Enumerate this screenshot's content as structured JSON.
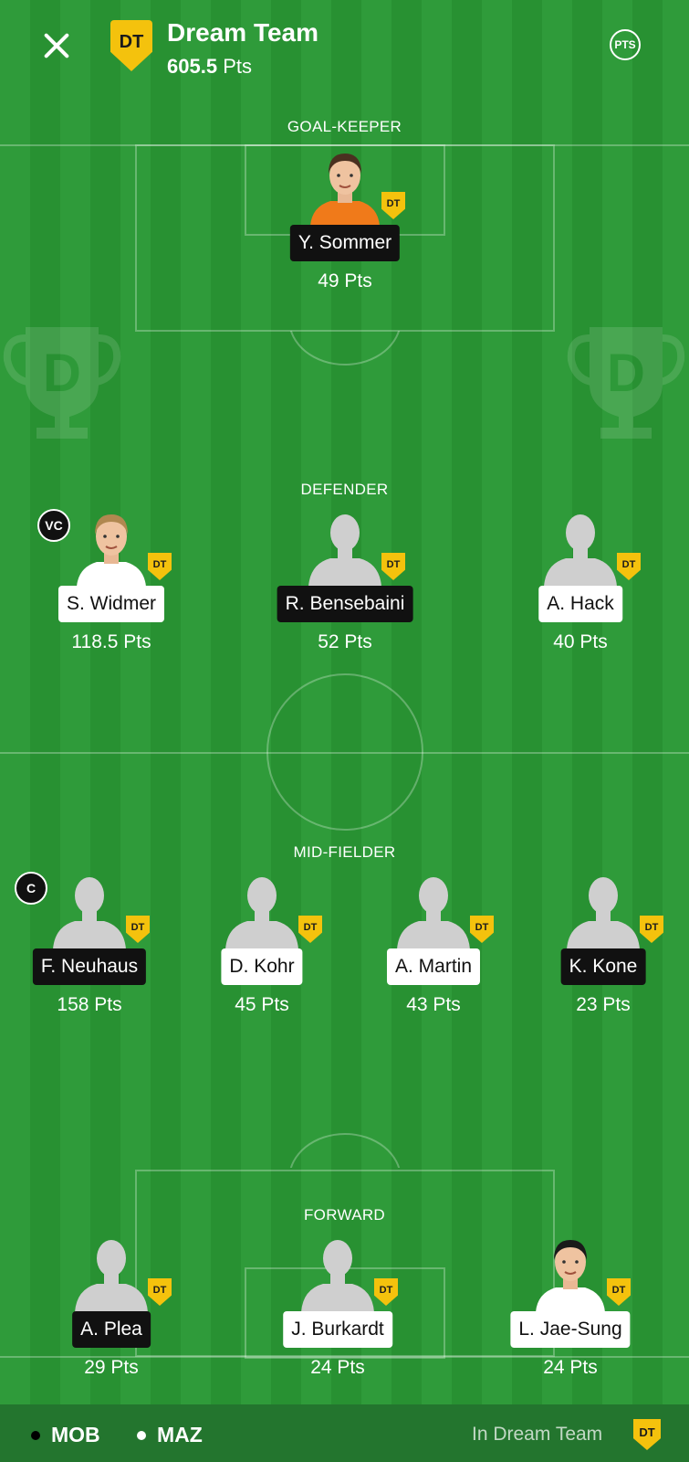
{
  "header": {
    "close_label": "close",
    "badge": "DT",
    "title": "Dream Team",
    "points_value": "605.5",
    "points_unit": "Pts",
    "pts_button": "PTS"
  },
  "sections": {
    "goalkeeper": "GOAL-KEEPER",
    "defender": "DEFENDER",
    "midfielder": "MID-FIELDER",
    "forward": "FORWARD"
  },
  "players": [
    {
      "name": "Y. Sommer",
      "points": "49 Pts",
      "badge": "DT",
      "tag": "dark",
      "photo": "keeper-photo"
    },
    {
      "name": "S. Widmer",
      "points": "118.5 Pts",
      "badge": "DT",
      "tag": "light",
      "role": "VC",
      "photo": "player-photo"
    },
    {
      "name": "R. Bensebaini",
      "points": "52 Pts",
      "badge": "DT",
      "tag": "dark",
      "photo": "placeholder"
    },
    {
      "name": "A. Hack",
      "points": "40 Pts",
      "badge": "DT",
      "tag": "light",
      "photo": "placeholder"
    },
    {
      "name": "F. Neuhaus",
      "points": "158 Pts",
      "badge": "DT",
      "tag": "dark",
      "role": "C",
      "photo": "placeholder"
    },
    {
      "name": "D. Kohr",
      "points": "45 Pts",
      "badge": "DT",
      "tag": "light",
      "photo": "placeholder"
    },
    {
      "name": "A. Martin",
      "points": "43 Pts",
      "badge": "DT",
      "tag": "light",
      "photo": "placeholder"
    },
    {
      "name": "K. Kone",
      "points": "23 Pts",
      "badge": "DT",
      "tag": "dark",
      "photo": "placeholder"
    },
    {
      "name": "A. Plea",
      "points": "29 Pts",
      "badge": "DT",
      "tag": "dark",
      "photo": "placeholder"
    },
    {
      "name": "J. Burkardt",
      "points": "24 Pts",
      "badge": "DT",
      "tag": "light",
      "photo": "placeholder"
    },
    {
      "name": "L. Jae-Sung",
      "points": "24 Pts",
      "badge": "DT",
      "tag": "light",
      "photo": "player-photo-2"
    }
  ],
  "footer": {
    "team1": {
      "label": "MOB",
      "color": "#000000"
    },
    "team2": {
      "label": "MAZ",
      "color": "#ffffff"
    },
    "in_dream_team": "In Dream Team",
    "badge": "DT"
  },
  "colors": {
    "pitch_light": "#2f9b3a",
    "pitch_dark": "#289132",
    "badge_yellow": "#f4c20d"
  }
}
